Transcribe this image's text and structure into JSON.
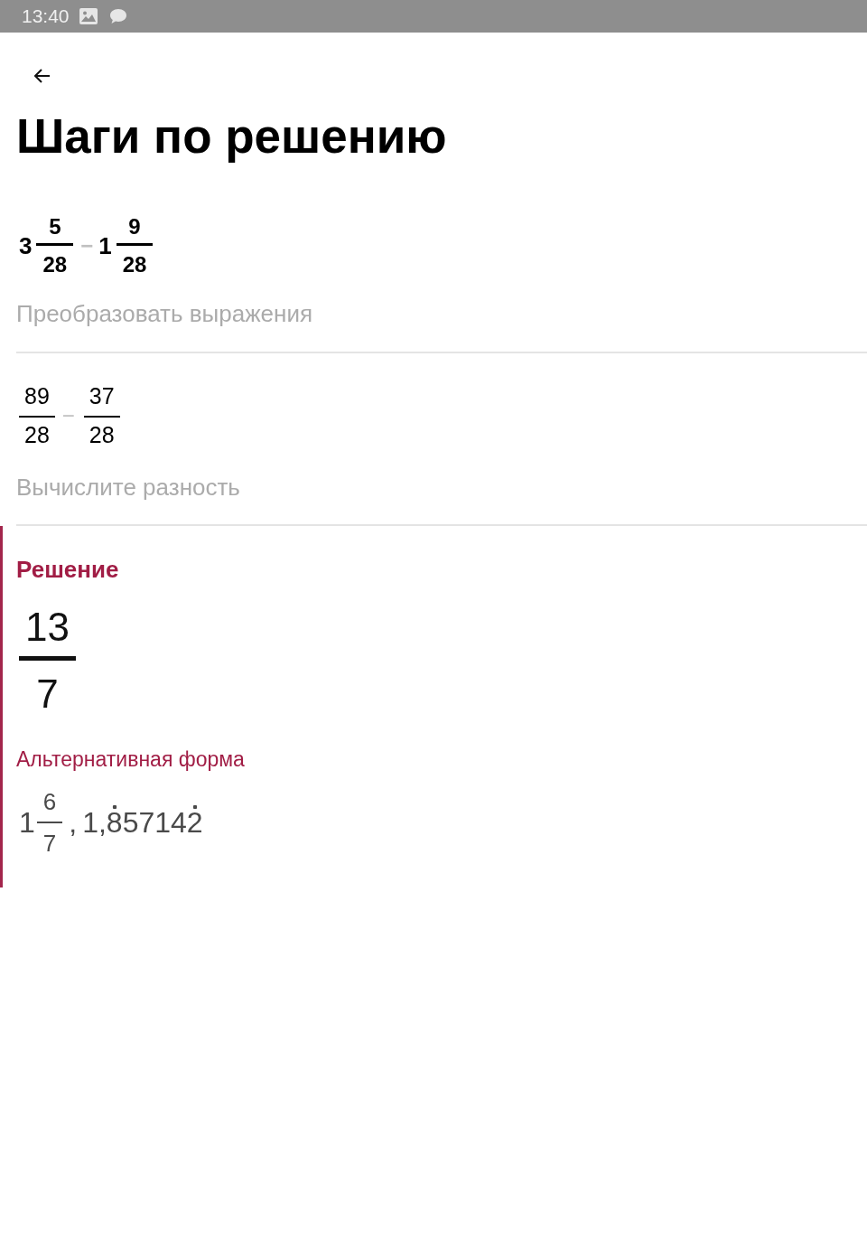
{
  "status_bar": {
    "time": "13:40"
  },
  "header": {
    "title": "Шаги по решению"
  },
  "steps": [
    {
      "expression": [
        {
          "kind": "mixed",
          "whole": "3",
          "numerator": "5",
          "denominator": "28"
        },
        {
          "kind": "operator",
          "text": "−"
        },
        {
          "kind": "mixed",
          "whole": "1",
          "numerator": "9",
          "denominator": "28"
        }
      ],
      "bold": true,
      "caption": "Преобразовать выражения"
    },
    {
      "expression": [
        {
          "kind": "fraction",
          "numerator": "89",
          "denominator": "28"
        },
        {
          "kind": "operator",
          "text": "−"
        },
        {
          "kind": "fraction",
          "numerator": "37",
          "denominator": "28"
        }
      ],
      "bold": false,
      "caption": "Вычислите разность"
    }
  ],
  "solution": {
    "heading": "Решение",
    "answer": [
      {
        "kind": "fraction",
        "numerator": "13",
        "denominator": "7"
      }
    ],
    "alternative_heading": "Альтернативная форма",
    "alternatives": [
      {
        "kind": "mixed",
        "whole": "1",
        "numerator": "6",
        "denominator": "7"
      },
      {
        "kind": "separator",
        "text": ","
      },
      {
        "kind": "number",
        "parts": [
          {
            "text": "1,",
            "dotted": false
          },
          {
            "text": "8",
            "dotted": true
          },
          {
            "text": "5714",
            "dotted": false
          },
          {
            "text": "2",
            "dotted": true
          }
        ]
      }
    ]
  }
}
